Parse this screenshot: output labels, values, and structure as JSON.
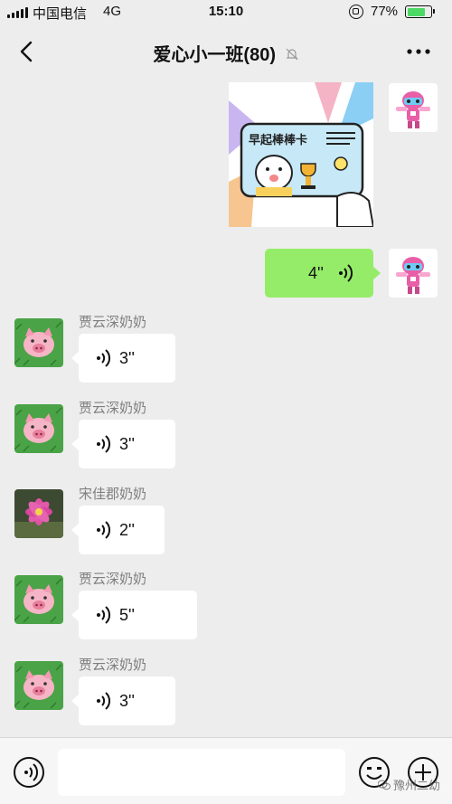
{
  "status_bar": {
    "carrier": "中国电信",
    "network": "4G",
    "time": "15:10",
    "battery": "77%",
    "battery_level": 0.77
  },
  "nav": {
    "title": "爱心小一班(80)"
  },
  "sticker": {
    "card_text": "早起棒棒卡"
  },
  "messages": [
    {
      "sender": "",
      "duration": "4''",
      "side": "right"
    },
    {
      "sender": "贾云深奶奶",
      "duration": "3''",
      "side": "left"
    },
    {
      "sender": "贾云深奶奶",
      "duration": "3''",
      "side": "left"
    },
    {
      "sender": "宋佳郡奶奶",
      "duration": "2''",
      "side": "left"
    },
    {
      "sender": "贾云深奶奶",
      "duration": "5''",
      "side": "left"
    },
    {
      "sender": "贾云深奶奶",
      "duration": "3''",
      "side": "left"
    }
  ],
  "input_bar": {
    "placeholder": ""
  },
  "watermark": "豫州二幼",
  "colors": {
    "background": "#ededed",
    "self_bubble": "#95ec69",
    "other_bubble": "#ffffff"
  }
}
